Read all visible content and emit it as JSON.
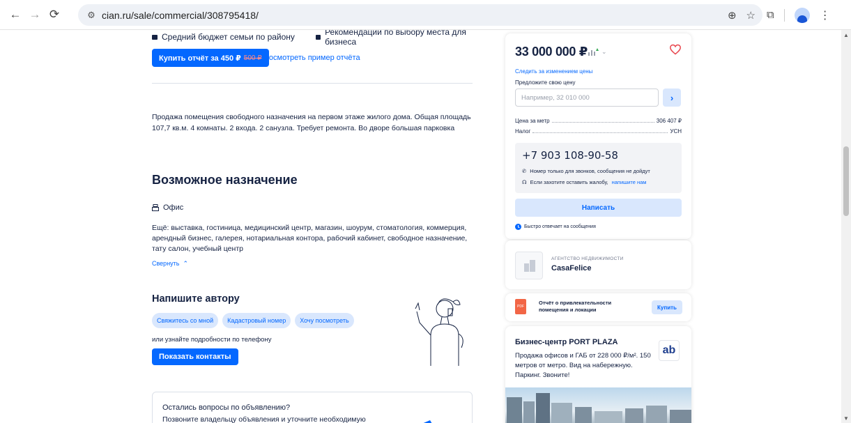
{
  "browser": {
    "url": "cian.ru/sale/commercial/308795418/"
  },
  "features": {
    "left": "Средний бюджет семьи по району",
    "right": "Рекомендации по выбору места для бизнеса"
  },
  "report": {
    "buy_label": "Купить отчёт за 450 ₽",
    "old_price": "500 ₽",
    "example_link": "Посмотреть пример отчёта"
  },
  "description": "Продажа помещения свободного назначения на первом этаже жилого дома. Общая площадь 107,7 кв.м. 4 комнаты. 2 входа. 2 санузла. Требует ремонта. Во дворе большая парковка",
  "purpose": {
    "title": "Возможное назначение",
    "main": "Офис",
    "more": "Ещё: выставка, гостиница, медицинский центр, магазин, шоурум, стоматология, коммерция, арендный бизнес, галерея, нотариальная контора, рабочий кабинет, свободное назначение, тату салон, учебный центр",
    "collapse": "Свернуть"
  },
  "author": {
    "title": "Напишите автору",
    "chips": [
      "Свяжитесь со мной",
      "Кадастровый номер",
      "Хочу посмотреть"
    ],
    "or_phone": "или узнайте подробности по телефону",
    "show_contacts": "Показать контакты"
  },
  "questions": {
    "title": "Остались вопросы по объявлению?",
    "subtitle": "Позвоните владельцу объявления и уточните необходимую"
  },
  "price_card": {
    "price": "33 000 000 ₽",
    "follow": "Следить за изменением цены",
    "offer_label": "Предложите свою цену",
    "offer_placeholder": "Например, 32 010 000",
    "per_meter_label": "Цена за метр",
    "per_meter_value": "306 407 ₽",
    "tax_label": "Налог",
    "tax_value": "УСН",
    "phone": "+7 903 108-90-58",
    "note_calls": "Номер только для звонков, сообщения не дойдут",
    "note_complaint": "Если захотите оставить жалобу,",
    "note_complaint_link": "напишите нам",
    "write_button": "Написать",
    "fast_reply": "Быстро отвечает на сообщения"
  },
  "agency": {
    "type": "АГЕНТСТВО НЕДВИЖИМОСТИ",
    "name": "CasaFelice"
  },
  "report_card": {
    "text": "Отчёт о привлекательности помещения и локации",
    "buy": "Купить",
    "icon_text": "PDF"
  },
  "ad": {
    "title": "Бизнес-центр PORT PLAZA",
    "text": "Продажа офисов и ГАБ от 228 000 ₽/м². 150 метров от метро. Вид на набережную. Паркинг. Звоните!",
    "logo": "ab"
  },
  "colors": {
    "accent": "#0468ff",
    "accent_light": "#d9e7fd",
    "text": "#152242",
    "heart": "#e8464e"
  }
}
